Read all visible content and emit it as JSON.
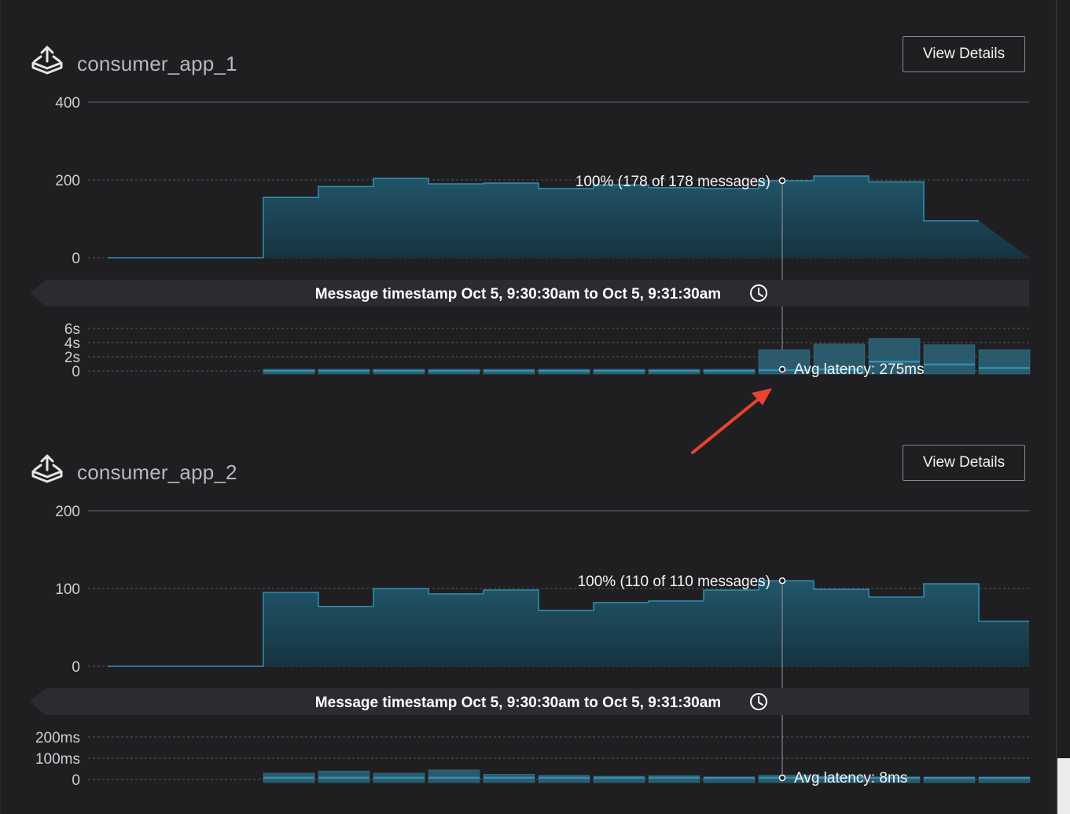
{
  "colors": {
    "background": "#1f1f22",
    "area_fill": "#1d4a5a",
    "area_stroke": "#2f8fb3",
    "latency_fill": "#2a5a6c",
    "annotation_arrow": "#e8432f"
  },
  "consumers": [
    {
      "name": "consumer_app_1",
      "icon": "inbox-upload-icon",
      "view_details_label": "View Details",
      "time_band_label": "Message timestamp Oct 5, 9:30:30am to Oct 5, 9:31:30am",
      "tooltip_messages": "100% (178 of 178 messages)",
      "tooltip_latency": "Avg latency: 275ms",
      "chart_data": {
        "type": "area",
        "ylim": [
          0,
          400
        ],
        "y_ticks": [
          "0",
          "200",
          "400"
        ],
        "y_tick_values": [
          0,
          200,
          400
        ],
        "values": [
          0,
          0,
          0,
          155,
          183,
          204,
          190,
          192,
          178,
          187,
          180,
          178,
          198,
          210,
          195,
          95
        ],
        "latency": {
          "type": "bar",
          "ylim": [
            0,
            6
          ],
          "y_ticks": [
            "0",
            "2s",
            "4s",
            "6s"
          ],
          "y_tick_values": [
            0,
            2,
            4,
            6
          ],
          "values": [
            null,
            null,
            null,
            0,
            0,
            0,
            0,
            0,
            0,
            0,
            0,
            0,
            3.0,
            3.8,
            4.6,
            3.7,
            3.0
          ],
          "averages": [
            null,
            null,
            null,
            0,
            0,
            0,
            0,
            0,
            0,
            0,
            0,
            0,
            0.1,
            0.2,
            1.3,
            0.9,
            0.4
          ]
        }
      }
    },
    {
      "name": "consumer_app_2",
      "icon": "inbox-upload-icon",
      "view_details_label": "View Details",
      "time_band_label": "Message timestamp Oct 5, 9:30:30am to Oct 5, 9:31:30am",
      "tooltip_messages": "100% (110 of 110 messages)",
      "tooltip_latency": "Avg latency: 8ms",
      "chart_data": {
        "type": "area",
        "ylim": [
          0,
          200
        ],
        "y_ticks": [
          "0",
          "100",
          "200"
        ],
        "y_tick_values": [
          0,
          100,
          200
        ],
        "values": [
          0,
          0,
          0,
          95,
          77,
          100,
          93,
          98,
          72,
          82,
          84,
          98,
          110,
          99,
          89,
          106,
          58
        ],
        "latency": {
          "type": "bar",
          "ylim": [
            0,
            200
          ],
          "y_ticks": [
            "0",
            "100ms",
            "200ms"
          ],
          "y_tick_values": [
            0,
            100,
            200
          ],
          "values": [
            null,
            null,
            null,
            30,
            40,
            30,
            45,
            25,
            20,
            15,
            18,
            12,
            20,
            15,
            12,
            10,
            10
          ],
          "averages": [
            null,
            null,
            null,
            8,
            8,
            8,
            8,
            8,
            8,
            8,
            8,
            8,
            8,
            8,
            8,
            8,
            8
          ]
        }
      }
    }
  ]
}
